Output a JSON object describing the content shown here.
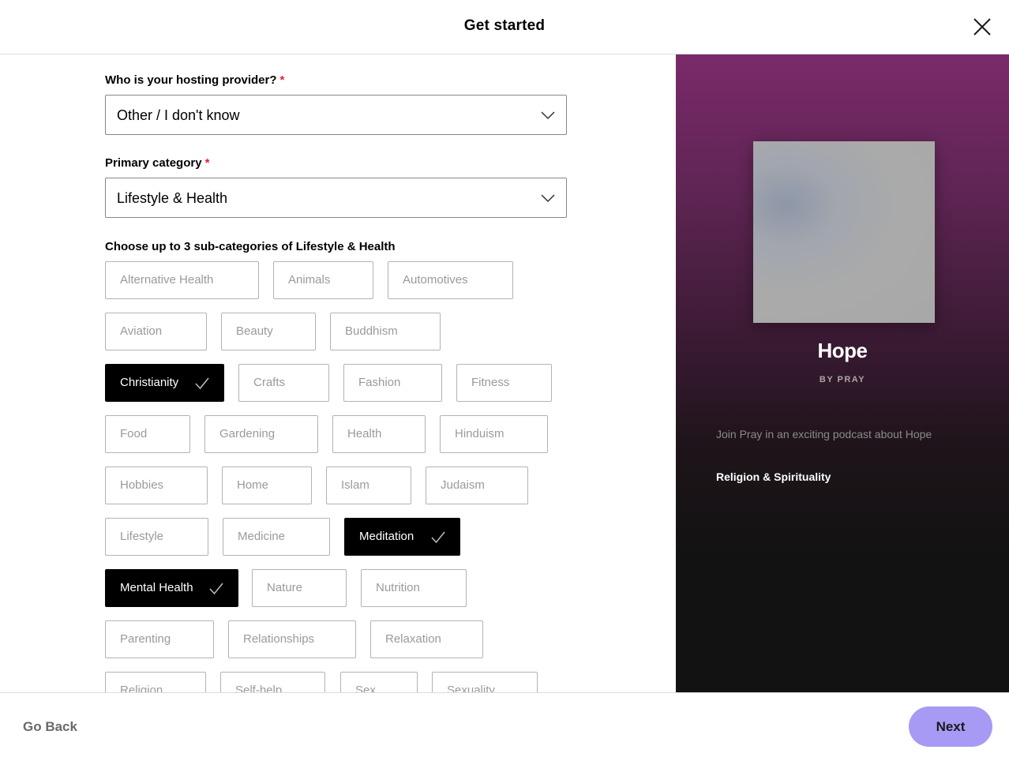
{
  "header": {
    "title": "Get started",
    "close_icon": "close-icon"
  },
  "form": {
    "hosting": {
      "label": "Who is your hosting provider?",
      "required_mark": "*",
      "value": "Other / I don't know"
    },
    "category": {
      "label": "Primary category",
      "required_mark": "*",
      "value": "Lifestyle & Health"
    },
    "subcategories": {
      "label": "Choose up to 3 sub-categories of Lifestyle & Health",
      "items": [
        {
          "label": "Alternative Health",
          "selected": false
        },
        {
          "label": "Animals",
          "selected": false
        },
        {
          "label": "Automotives",
          "selected": false
        },
        {
          "label": "Aviation",
          "selected": false
        },
        {
          "label": "Beauty",
          "selected": false
        },
        {
          "label": "Buddhism",
          "selected": false
        },
        {
          "label": "Christianity",
          "selected": true
        },
        {
          "label": "Crafts",
          "selected": false
        },
        {
          "label": "Fashion",
          "selected": false
        },
        {
          "label": "Fitness",
          "selected": false
        },
        {
          "label": "Food",
          "selected": false
        },
        {
          "label": "Gardening",
          "selected": false
        },
        {
          "label": "Health",
          "selected": false
        },
        {
          "label": "Hinduism",
          "selected": false
        },
        {
          "label": "Hobbies",
          "selected": false
        },
        {
          "label": "Home",
          "selected": false
        },
        {
          "label": "Islam",
          "selected": false
        },
        {
          "label": "Judaism",
          "selected": false
        },
        {
          "label": "Lifestyle",
          "selected": false
        },
        {
          "label": "Medicine",
          "selected": false
        },
        {
          "label": "Meditation",
          "selected": true
        },
        {
          "label": "Mental Health",
          "selected": true
        },
        {
          "label": "Nature",
          "selected": false
        },
        {
          "label": "Nutrition",
          "selected": false
        },
        {
          "label": "Parenting",
          "selected": false
        },
        {
          "label": "Relationships",
          "selected": false
        },
        {
          "label": "Relaxation",
          "selected": false
        },
        {
          "label": "Religion",
          "selected": false
        },
        {
          "label": "Self-help",
          "selected": false
        },
        {
          "label": "Sex",
          "selected": false
        },
        {
          "label": "Sexuality",
          "selected": false
        }
      ]
    }
  },
  "preview": {
    "title": "Hope",
    "author": "BY PRAY",
    "description": "Join Pray in an exciting podcast about Hope",
    "category": "Religion & Spirituality"
  },
  "footer": {
    "back_label": "Go Back",
    "next_label": "Next"
  },
  "colors": {
    "accent": "#a69af5",
    "selected_chip": "#000000",
    "required": "#e22134"
  }
}
